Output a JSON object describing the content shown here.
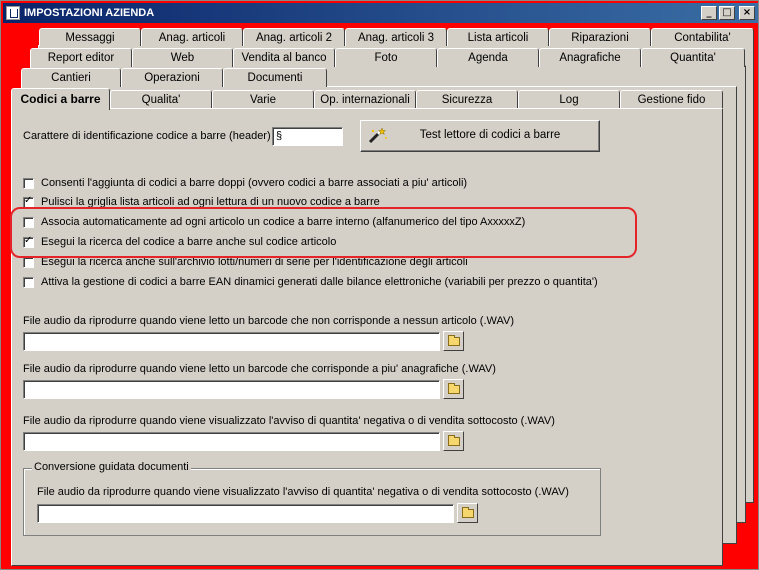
{
  "window": {
    "title": "IMPOSTAZIONI AZIENDA",
    "controls": {
      "minimize": "_",
      "maximize": "□",
      "close": "×"
    }
  },
  "tabs": {
    "row1": [
      "Messaggi",
      "Anag. articoli",
      "Anag. articoli 2",
      "Anag. articoli 3",
      "Lista articoli",
      "Riparazioni",
      "Contabilita'"
    ],
    "row2": [
      "Report editor",
      "Web",
      "Vendita al banco",
      "Foto",
      "Agenda",
      "Anagrafiche",
      "Quantita'"
    ],
    "row3": [
      "Cantieri",
      "Operazioni",
      "Documenti"
    ],
    "row4": [
      "Codici a barre",
      "Qualita'",
      "Varie",
      "Op. internazionali",
      "Sicurezza",
      "Log",
      "Gestione fido"
    ],
    "active": "Codici a barre"
  },
  "header_char": {
    "label": "Carattere di identificazione codice a barre (header) :",
    "value": "§"
  },
  "test_button": {
    "label": "Test lettore di codici a barre",
    "icon": "magic-wand-icon"
  },
  "checkboxes": [
    {
      "label": "Consenti l'aggiunta di codici a barre doppi (ovvero codici a barre associati a piu' articoli)",
      "checked": false
    },
    {
      "label": "Pulisci la griglia lista articoli ad ogni lettura di un nuovo codice a barre",
      "checked": true
    },
    {
      "label": "Associa automaticamente ad ogni articolo un codice a barre interno (alfanumerico del tipo AxxxxxZ)",
      "checked": false
    },
    {
      "label": "Esegui la ricerca del codice a barre anche sul codice articolo",
      "checked": true
    },
    {
      "label": "Esegui la ricerca anche sull'archivio lotti/numeri di serie per l'identificazione degli articoli",
      "checked": false
    },
    {
      "label": "Attiva la gestione di codici a barre EAN dinamici generati dalle bilance elettroniche (variabili per prezzo o quantita')",
      "checked": false
    }
  ],
  "audio_files": [
    {
      "label": "File audio da riprodurre quando viene letto un barcode che non corrisponde a nessun articolo (.WAV)",
      "value": ""
    },
    {
      "label": "File audio da riprodurre quando viene letto un barcode che corrisponde a piu' anagrafiche (.WAV)",
      "value": ""
    },
    {
      "label": "File audio da riprodurre quando viene visualizzato l'avviso di quantita' negativa o di vendita sottocosto (.WAV)",
      "value": ""
    }
  ],
  "conversion_group": {
    "title": "Conversione guidata documenti",
    "label": "File audio da riprodurre quando viene visualizzato l'avviso di quantita' negativa o di vendita sottocosto (.WAV)",
    "value": ""
  },
  "colors": {
    "highlight": "#e5242a",
    "background": "#ff0000",
    "face": "#d4d0c8"
  }
}
